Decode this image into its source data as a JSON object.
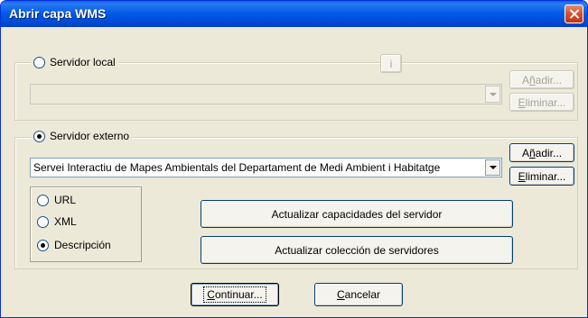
{
  "window": {
    "title": "Abrir capa WMS"
  },
  "local": {
    "label": "Servidor local",
    "info_label": "i",
    "combo_value": "",
    "add_label_prefix": "A",
    "add_label_ul": "ñ",
    "add_label_rest": "adir...",
    "remove_label_ul": "E",
    "remove_label_rest": "liminar..."
  },
  "external": {
    "label": "Servidor externo",
    "combo_value": "Servei Interactiu de Mapes Ambientals del Departament de Medi Ambient i Habitatge",
    "add_label_prefix": "A",
    "add_label_ul": "ñ",
    "add_label_rest": "adir...",
    "remove_label_ul": "E",
    "remove_label_rest": "liminar...",
    "options": [
      {
        "label": "URL",
        "checked": false
      },
      {
        "label": "XML",
        "checked": false
      },
      {
        "label": "Descripción",
        "checked": true
      }
    ],
    "update_capabilities_label": "Actualizar capacidades del servidor",
    "update_collection_label": "Actualizar colección de servidores"
  },
  "footer": {
    "continue_ul": "C",
    "continue_rest": "ontinuar...",
    "cancel_ul": "C",
    "cancel_rest": "ancelar"
  }
}
